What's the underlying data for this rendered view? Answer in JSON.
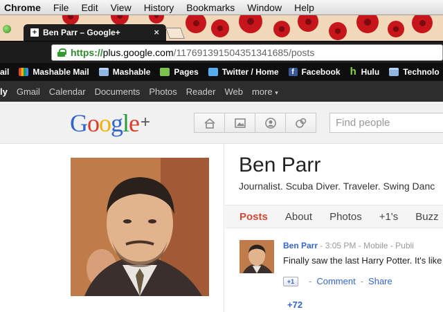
{
  "menubar": {
    "app": "Chrome",
    "items": [
      "File",
      "Edit",
      "View",
      "History",
      "Bookmarks",
      "Window",
      "Help"
    ]
  },
  "browser_tab": {
    "title": "Ben Parr – Google+",
    "close": "×"
  },
  "address": {
    "scheme": "https://",
    "host": "plus.google.com",
    "path": "/117691391504351341685/posts"
  },
  "bookmarks": [
    {
      "label": "ail",
      "icon": "none"
    },
    {
      "label": "Mashable Mail",
      "icon": "gmail-icon"
    },
    {
      "label": "Mashable",
      "icon": "folder-icon"
    },
    {
      "label": "Pages",
      "icon": "pages-icon"
    },
    {
      "label": "Twitter / Home",
      "icon": "twitter-icon"
    },
    {
      "label": "Facebook",
      "icon": "facebook-icon"
    },
    {
      "label": "Hulu",
      "icon": "hulu-icon"
    },
    {
      "label": "Technolo",
      "icon": "folder-icon"
    }
  ],
  "gbar": {
    "items": [
      "ly",
      "Gmail",
      "Calendar",
      "Documents",
      "Photos",
      "Reader",
      "Web",
      "more"
    ],
    "more_caret": "▾"
  },
  "gplus": {
    "logo_letters": [
      {
        "ch": "G",
        "color": "#3366cc"
      },
      {
        "ch": "o",
        "color": "#dd3b27"
      },
      {
        "ch": "o",
        "color": "#f0b400"
      },
      {
        "ch": "g",
        "color": "#3366cc"
      },
      {
        "ch": "l",
        "color": "#2a9a3e"
      },
      {
        "ch": "e",
        "color": "#dd3b27"
      }
    ],
    "logo_plus": "+",
    "nav_icons": [
      "home-icon",
      "photos-icon",
      "profile-icon",
      "circles-icon"
    ],
    "search_placeholder": "Find people"
  },
  "profile": {
    "name": "Ben Parr",
    "tagline": "Journalist. Scuba Diver. Traveler. Swing Danc",
    "tabs": [
      "Posts",
      "About",
      "Photos",
      "+1's",
      "Buzz"
    ],
    "active_tab": "Posts"
  },
  "post": {
    "author": "Ben Parr",
    "time": "3:05 PM",
    "source": "Mobile",
    "visibility": "Publi",
    "text": "Finally saw the last Harry Potter. It's like",
    "plusone_label": "+1",
    "comment_label": "Comment",
    "share_label": "Share",
    "plus_count": "+72"
  }
}
